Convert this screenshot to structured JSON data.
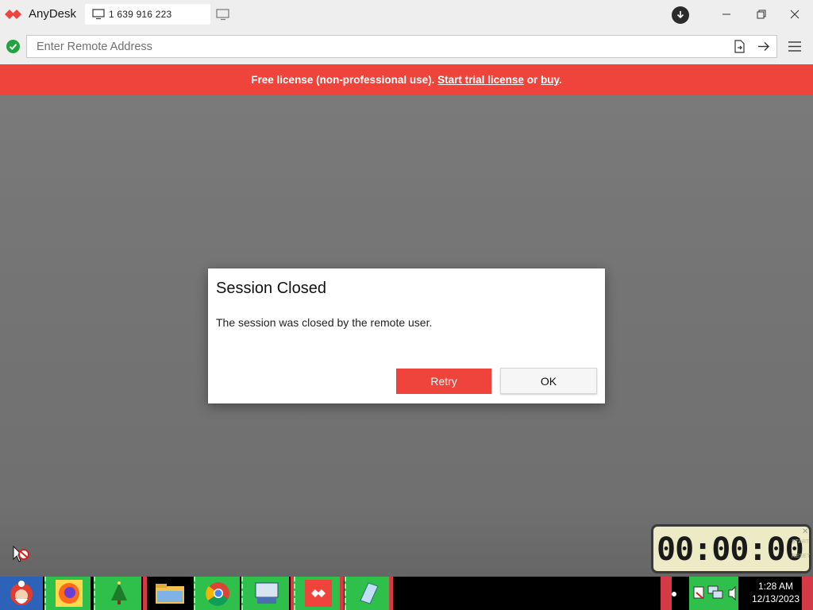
{
  "app": {
    "name": "AnyDesk",
    "id_tab": "1 639 916 223"
  },
  "address_bar": {
    "placeholder": "Enter Remote Address",
    "value": ""
  },
  "banner": {
    "text": "Free license (non-professional use).",
    "trial_link": "Start trial license",
    "or": "or",
    "buy_link": "buy",
    "end": "."
  },
  "dialog": {
    "title": "Session Closed",
    "message": "The session was closed by the remote user.",
    "retry_label": "Retry",
    "ok_label": "OK"
  },
  "timer": {
    "display": "00:00:00",
    "start_label": "START",
    "reset_label": "RESET"
  },
  "taskbar": {
    "time": "1:28 AM",
    "date": "12/13/2023"
  },
  "colors": {
    "accent": "#ef443b",
    "status_ok": "#23a340",
    "remote_bg": "#747474"
  },
  "icons": [
    "anydesk-logo-icon",
    "monitor-icon",
    "new-tab-icon",
    "download-icon",
    "minimize-icon",
    "maximize-icon",
    "close-icon",
    "status-ok-icon",
    "file-transfer-icon",
    "arrow-right-icon",
    "hamburger-menu-icon",
    "no-input-icon"
  ]
}
